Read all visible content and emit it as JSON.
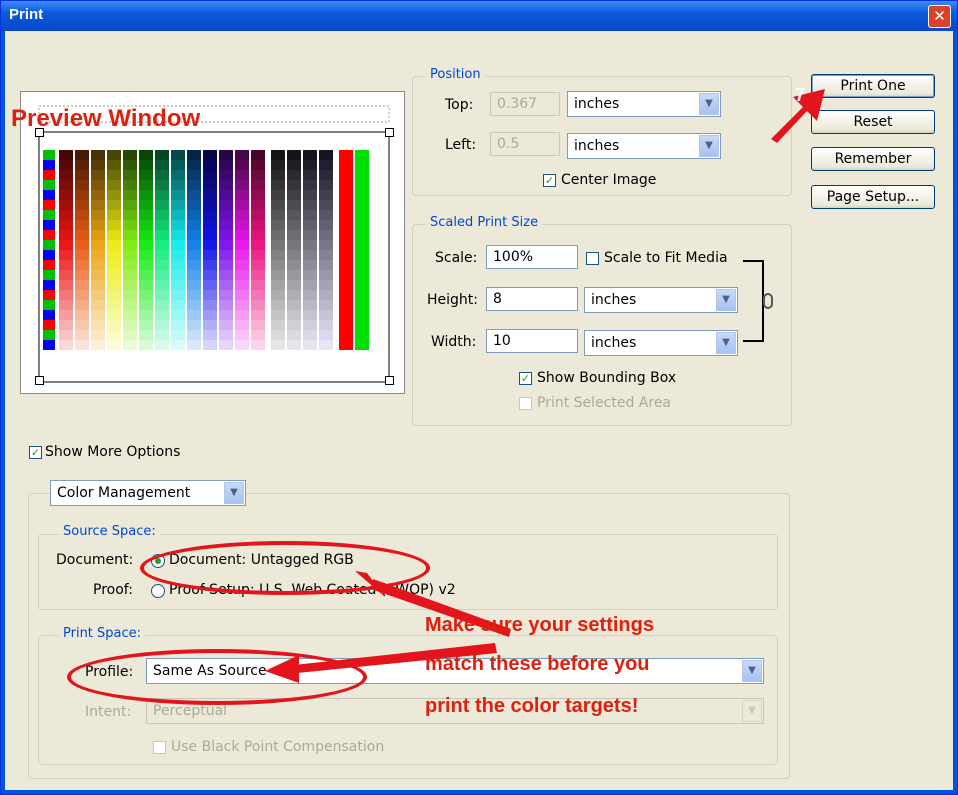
{
  "window": {
    "title": "Print",
    "close": "✕"
  },
  "preview": {
    "annotation": "Preview Window"
  },
  "position": {
    "legend": "Position",
    "top_label": "Top:",
    "top_value": "0.367",
    "top_unit": "inches",
    "left_label": "Left:",
    "left_value": "0.5",
    "left_unit": "inches",
    "center_label": "Center Image",
    "center_checked": true
  },
  "scaled": {
    "legend": "Scaled Print Size",
    "scale_label": "Scale:",
    "scale_value": "100%",
    "fit_label": "Scale to Fit Media",
    "height_label": "Height:",
    "height_value": "8",
    "height_unit": "inches",
    "width_label": "Width:",
    "width_value": "10",
    "width_unit": "inches",
    "bbox_label": "Show Bounding Box",
    "selected_label": "Print Selected Area"
  },
  "buttons": {
    "print_one": "Print One",
    "reset": "Reset",
    "remember": "Remember",
    "page_setup": "Page Setup..."
  },
  "step_badge": "7",
  "more_options": {
    "label": "Show More Options",
    "select": "Color Management"
  },
  "source": {
    "legend": "Source Space:",
    "doc_label": "Document:",
    "doc_option": "Document:  Untagged RGB",
    "proof_label": "Proof:",
    "proof_option": "Proof Setup:  U.S. Web Coated (SWOP) v2"
  },
  "print_space": {
    "legend": "Print Space:",
    "profile_label": "Profile:",
    "profile_value": "Same As Source",
    "intent_label": "Intent:",
    "intent_value": "Perceptual",
    "bpc_label": "Use Black Point Compensation"
  },
  "instruction": [
    "Make sure your settings",
    "match these before you",
    "print the color targets!"
  ],
  "colors": {
    "annotation_red": "#e3141b",
    "legend_blue": "#0046d5",
    "dialog_bg": "#ece9d8"
  }
}
